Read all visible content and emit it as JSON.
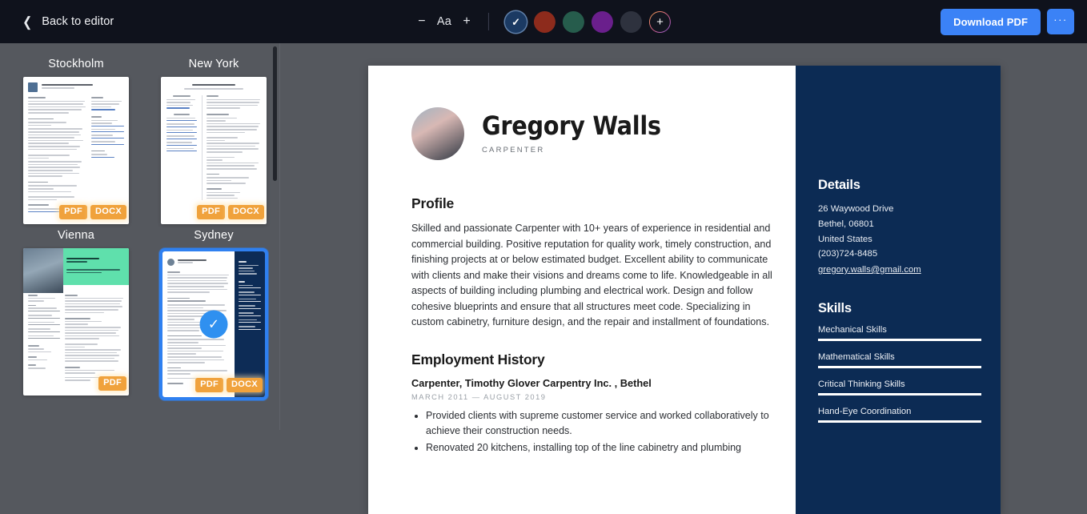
{
  "topbar": {
    "back_label": "Back to editor",
    "back_icon": "chevron-left-icon",
    "font_decrease": "−",
    "font_label": "Aa",
    "font_increase": "+",
    "color_swatches": [
      {
        "name": "navy-blue",
        "hex": "#1b3a63",
        "selected": true,
        "check": "✓"
      },
      {
        "name": "brick-red",
        "hex": "#8d2b1c",
        "selected": false
      },
      {
        "name": "forest-green",
        "hex": "#265c4c",
        "selected": false
      },
      {
        "name": "purple",
        "hex": "#6a1f8c",
        "selected": false
      },
      {
        "name": "charcoal",
        "hex": "#2e323e",
        "selected": false
      }
    ],
    "add_color_label": "+",
    "download_label": "Download PDF",
    "more_label": "···"
  },
  "templates": [
    {
      "name": "Stockholm",
      "selected": false,
      "badges": [
        "PDF",
        "DOCX"
      ]
    },
    {
      "name": "New York",
      "selected": false,
      "badges": [
        "PDF",
        "DOCX"
      ]
    },
    {
      "name": "Vienna",
      "selected": false,
      "badges": [
        "PDF"
      ]
    },
    {
      "name": "Sydney",
      "selected": true,
      "badges": [
        "PDF",
        "DOCX"
      ],
      "check": "✓"
    }
  ],
  "resume": {
    "name": "Gregory Walls",
    "role": "CARPENTER",
    "profile_heading": "Profile",
    "profile_text": "Skilled and passionate Carpenter with 10+ years of experience in residential and commercial building. Positive reputation for quality work, timely construction, and finishing projects at or below estimated budget. Excellent ability to communicate with clients and make their visions and dreams come to life. Knowledgeable in all aspects of building including plumbing and electrical work. Design and follow cohesive blueprints and ensure that all structures meet code. Specializing in custom cabinetry, furniture design, and the repair and installment of foundations.",
    "employment_heading": "Employment History",
    "job_title": "Carpenter, Timothy Glover Carpentry Inc. , Bethel",
    "job_dates": "MARCH 2011 — AUGUST 2019",
    "job_bullets": [
      "Provided clients with supreme customer service and worked collaboratively to achieve their construction needs.",
      "Renovated 20 kitchens, installing top of the line cabinetry and plumbing"
    ],
    "details_heading": "Details",
    "details": [
      "26 Waywood Drive",
      "Bethel, 06801",
      "United States",
      "(203)724-8485"
    ],
    "email": "gregory.walls@gmail.com",
    "skills_heading": "Skills",
    "skills": [
      {
        "label": "Mechanical Skills",
        "level": 100
      },
      {
        "label": "Mathematical Skills",
        "level": 100
      },
      {
        "label": "Critical Thinking Skills",
        "level": 100
      },
      {
        "label": "Hand-Eye Coordination",
        "level": 100
      }
    ]
  },
  "colors": {
    "accent_blue": "#3b82f6",
    "badge_orange": "#f0a23c",
    "resume_navy": "#0c2b54",
    "workspace_gray": "#55585e",
    "topbar_dark": "#0f121c"
  }
}
